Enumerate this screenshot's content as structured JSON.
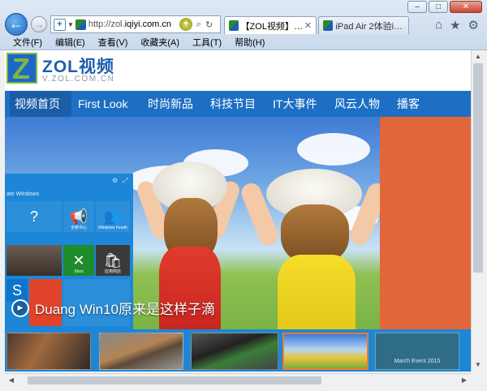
{
  "window": {
    "controls": {
      "minimize": "–",
      "maximize": "□",
      "close": "✕"
    }
  },
  "toolbar": {
    "back_icon": "back-arrow-icon",
    "forward_icon": "forward-arrow-icon",
    "address": {
      "url_prefix": "http://zol.",
      "url_domain": "iqiyi.com.cn",
      "pin_glyph": "+",
      "refresh_glyph": "↻",
      "stop_glyph": "⌕"
    },
    "right_icons": {
      "home": "⌂",
      "favorites": "★",
      "tools": "⚙"
    }
  },
  "tabs": [
    {
      "label": "【ZOL视频】科…",
      "close": "✕",
      "active": true
    },
    {
      "label": "iPad Air 2体验iOS…",
      "active": false
    }
  ],
  "menu": {
    "items": [
      "文件(F)",
      "编辑(E)",
      "查看(V)",
      "收藏夹(A)",
      "工具(T)",
      "帮助(H)"
    ]
  },
  "site": {
    "logo_name": "ZOL视频",
    "logo_sub": "V.ZOL.COM.CN",
    "nav": [
      "视频首页",
      "First Look",
      "时尚新品",
      "科技节目",
      "IT大事件",
      "风云人物",
      "播客"
    ],
    "hero_caption": "Duang Win10原来是这样子滴",
    "startmenu": {
      "header": "ate Windows",
      "tiles": [
        {
          "glyph": "?",
          "label": ""
        },
        {
          "glyph": "📢",
          "label": "全新中心"
        },
        {
          "glyph": "👥",
          "label": "Windows Feedb"
        },
        {
          "glyph": "",
          "label": ""
        },
        {
          "glyph": "✕",
          "label": "Xbox"
        },
        {
          "glyph": "🛍",
          "label": "应用商店"
        }
      ]
    },
    "thumb_overlay": "March Event 2015"
  },
  "colors": {
    "nav_blue": "#1d6fc4",
    "orange": "#e2663a",
    "tile_blue": "#1d86d7",
    "selected_thumb_border": "#f07a2a"
  }
}
